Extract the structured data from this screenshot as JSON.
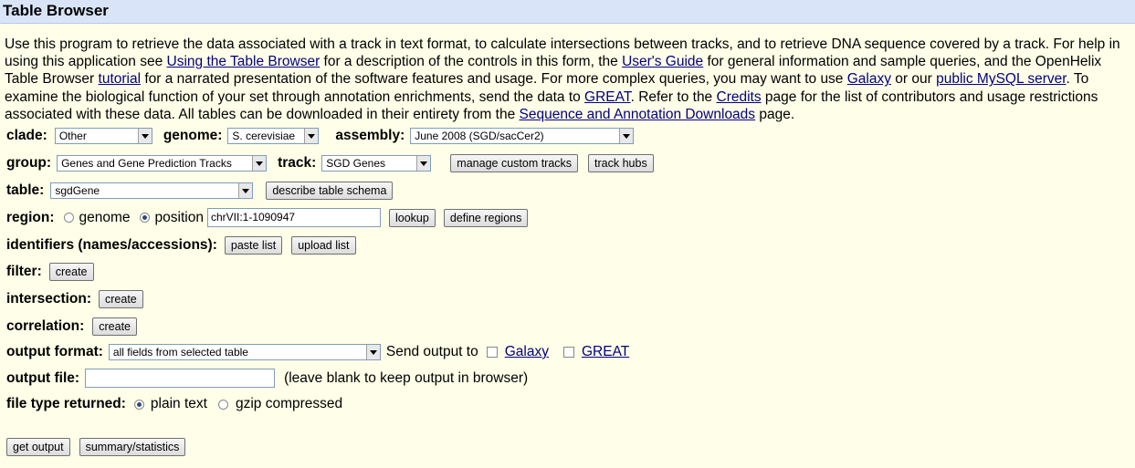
{
  "title": "Table Browser",
  "intro": {
    "t1": "Use this program to retrieve the data associated with a track in text format, to calculate intersections between tracks, and to retrieve DNA sequence covered by a track. For help in using this application see ",
    "link_using": "Using the Table Browser",
    "t2": " for a description of the controls in this form, the ",
    "link_guide": "User's Guide",
    "t3": " for general information and sample queries, and the OpenHelix Table Browser ",
    "link_tutorial": "tutorial",
    "t4": " for a narrated presentation of the software features and usage. For more complex queries, you may want to use ",
    "link_galaxy": "Galaxy",
    "t5": " or our ",
    "link_mysql": "public MySQL server",
    "t6": ". To examine the biological function of your set through annotation enrichments, send the data to ",
    "link_great": "GREAT",
    "t7": ". Refer to the ",
    "link_credits": "Credits",
    "t8": " page for the list of contributors and usage restrictions associated with these data. All tables can be downloaded in their entirety from the ",
    "link_downloads": "Sequence and Annotation Downloads",
    "t9": " page."
  },
  "clade": {
    "label": "clade:",
    "value": "Other"
  },
  "genome": {
    "label": "genome:",
    "value": "S. cerevisiae"
  },
  "assembly": {
    "label": "assembly:",
    "value": "June 2008 (SGD/sacCer2)"
  },
  "group": {
    "label": "group:",
    "value": "Genes and Gene Prediction Tracks"
  },
  "track": {
    "label": "track:",
    "value": "SGD Genes"
  },
  "buttons": {
    "manage_custom": "manage custom tracks",
    "track_hubs": "track hubs",
    "describe_schema": "describe table schema",
    "lookup": "lookup",
    "define_regions": "define regions",
    "paste_list": "paste list",
    "upload_list": "upload list",
    "create": "create",
    "get_output": "get output",
    "summary": "summary/statistics"
  },
  "table": {
    "label": "table:",
    "value": "sgdGene"
  },
  "region": {
    "label": "region:",
    "opt_genome": "genome",
    "opt_position": "position",
    "position_value": "chrVII:1-1090947"
  },
  "identifiers": {
    "label": "identifiers (names/accessions):"
  },
  "filter": {
    "label": "filter:"
  },
  "intersection": {
    "label": "intersection:"
  },
  "correlation": {
    "label": "correlation:"
  },
  "output_format": {
    "label": "output format:",
    "value": "all fields from selected table",
    "send_label": "Send output to",
    "galaxy": "Galaxy",
    "great": "GREAT"
  },
  "output_file": {
    "label": "output file:",
    "value": "",
    "hint": "(leave blank to keep output in browser)"
  },
  "file_type": {
    "label": "file type returned:",
    "plain": "plain text",
    "gzip": "gzip compressed"
  }
}
